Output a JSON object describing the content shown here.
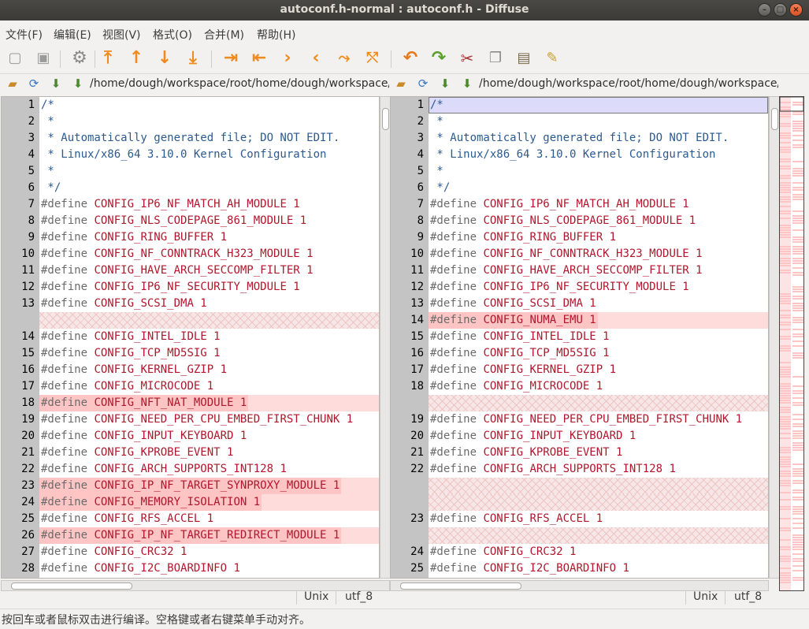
{
  "window": {
    "title": "autoconf.h-normal : autoconf.h - Diffuse"
  },
  "menu": [
    "文件(F)",
    "编辑(E)",
    "视图(V)",
    "格式(O)",
    "合并(M)",
    "帮助(H)"
  ],
  "toolbar": {
    "icons": [
      "new-2-way-merge-icon",
      "new-3-way-merge-icon",
      "realign-icon",
      "first-difference-icon",
      "previous-difference-icon",
      "next-difference-icon",
      "last-difference-icon",
      "copy-selection-right-icon",
      "copy-selection-left-icon",
      "copy-right-icon",
      "copy-left-icon",
      "merge-from-left-icon",
      "merge-from-right-icon",
      "undo-icon",
      "redo-icon",
      "cut-icon",
      "copy-icon",
      "paste-icon",
      "clear-edits-icon"
    ]
  },
  "colors": {
    "changed_line": "#ffdcdc",
    "changed_text": "#ffc4c4",
    "gutter": "#c4c4c4",
    "selection": "#dcdcfa"
  },
  "left": {
    "path": "/home/dough/workspace/root/home/dough/workspace/",
    "format": "Unix",
    "encoding": "utf_8",
    "rows": [
      {
        "n": "1",
        "text": "/*",
        "kind": "comment"
      },
      {
        "n": "2",
        "text": " *",
        "kind": "comment"
      },
      {
        "n": "3",
        "text": " * Automatically generated file; DO NOT EDIT.",
        "kind": "comment"
      },
      {
        "n": "4",
        "text": " * Linux/x86_64 3.10.0 Kernel Configuration",
        "kind": "comment"
      },
      {
        "n": "5",
        "text": " *",
        "kind": "comment"
      },
      {
        "n": "6",
        "text": " */",
        "kind": "comment"
      },
      {
        "n": "7",
        "text": "CONFIG_IP6_NF_MATCH_AH_MODULE 1",
        "kind": "define"
      },
      {
        "n": "8",
        "text": "CONFIG_NLS_CODEPAGE_861_MODULE 1",
        "kind": "define"
      },
      {
        "n": "9",
        "text": "CONFIG_RING_BUFFER 1",
        "kind": "define"
      },
      {
        "n": "10",
        "text": "CONFIG_NF_CONNTRACK_H323_MODULE 1",
        "kind": "define"
      },
      {
        "n": "11",
        "text": "CONFIG_HAVE_ARCH_SECCOMP_FILTER 1",
        "kind": "define"
      },
      {
        "n": "12",
        "text": "CONFIG_IP6_NF_SECURITY_MODULE 1",
        "kind": "define"
      },
      {
        "n": "13",
        "text": "CONFIG_SCSI_DMA 1",
        "kind": "define"
      },
      {
        "n": "",
        "text": "",
        "kind": "gap"
      },
      {
        "n": "14",
        "text": "CONFIG_INTEL_IDLE 1",
        "kind": "define"
      },
      {
        "n": "15",
        "text": "CONFIG_TCP_MD5SIG 1",
        "kind": "define"
      },
      {
        "n": "16",
        "text": "CONFIG_KERNEL_GZIP 1",
        "kind": "define"
      },
      {
        "n": "17",
        "text": "CONFIG_MICROCODE 1",
        "kind": "define"
      },
      {
        "n": "18",
        "text": "CONFIG_NFT_NAT_MODULE 1",
        "kind": "define-changed"
      },
      {
        "n": "19",
        "text": "CONFIG_NEED_PER_CPU_EMBED_FIRST_CHUNK 1",
        "kind": "define"
      },
      {
        "n": "20",
        "text": "CONFIG_INPUT_KEYBOARD 1",
        "kind": "define"
      },
      {
        "n": "21",
        "text": "CONFIG_KPROBE_EVENT 1",
        "kind": "define"
      },
      {
        "n": "22",
        "text": "CONFIG_ARCH_SUPPORTS_INT128 1",
        "kind": "define"
      },
      {
        "n": "23",
        "text": "CONFIG_IP_NF_TARGET_SYNPROXY_MODULE 1",
        "kind": "define-changed"
      },
      {
        "n": "24",
        "text": "CONFIG_MEMORY_ISOLATION 1",
        "kind": "define-changed"
      },
      {
        "n": "25",
        "text": "CONFIG_RFS_ACCEL 1",
        "kind": "define"
      },
      {
        "n": "26",
        "text": "CONFIG_IP_NF_TARGET_REDIRECT_MODULE 1",
        "kind": "define-changed"
      },
      {
        "n": "27",
        "text": "CONFIG_CRC32 1",
        "kind": "define"
      },
      {
        "n": "28",
        "text": "CONFIG_I2C_BOARDINFO 1",
        "kind": "define"
      }
    ]
  },
  "right": {
    "path": "/home/dough/workspace/root/home/dough/workspace/",
    "format": "Unix",
    "encoding": "utf_8",
    "rows": [
      {
        "n": "1",
        "text": "/*",
        "kind": "comment-selected"
      },
      {
        "n": "2",
        "text": " *",
        "kind": "comment"
      },
      {
        "n": "3",
        "text": " * Automatically generated file; DO NOT EDIT.",
        "kind": "comment"
      },
      {
        "n": "4",
        "text": " * Linux/x86_64 3.10.0 Kernel Configuration",
        "kind": "comment"
      },
      {
        "n": "5",
        "text": " *",
        "kind": "comment"
      },
      {
        "n": "6",
        "text": " */",
        "kind": "comment"
      },
      {
        "n": "7",
        "text": "CONFIG_IP6_NF_MATCH_AH_MODULE 1",
        "kind": "define"
      },
      {
        "n": "8",
        "text": "CONFIG_NLS_CODEPAGE_861_MODULE 1",
        "kind": "define"
      },
      {
        "n": "9",
        "text": "CONFIG_RING_BUFFER 1",
        "kind": "define"
      },
      {
        "n": "10",
        "text": "CONFIG_NF_CONNTRACK_H323_MODULE 1",
        "kind": "define"
      },
      {
        "n": "11",
        "text": "CONFIG_HAVE_ARCH_SECCOMP_FILTER 1",
        "kind": "define"
      },
      {
        "n": "12",
        "text": "CONFIG_IP6_NF_SECURITY_MODULE 1",
        "kind": "define"
      },
      {
        "n": "13",
        "text": "CONFIG_SCSI_DMA 1",
        "kind": "define"
      },
      {
        "n": "14",
        "text": "CONFIG_NUMA_EMU 1",
        "kind": "define-changed"
      },
      {
        "n": "15",
        "text": "CONFIG_INTEL_IDLE 1",
        "kind": "define"
      },
      {
        "n": "16",
        "text": "CONFIG_TCP_MD5SIG 1",
        "kind": "define"
      },
      {
        "n": "17",
        "text": "CONFIG_KERNEL_GZIP 1",
        "kind": "define"
      },
      {
        "n": "18",
        "text": "CONFIG_MICROCODE 1",
        "kind": "define"
      },
      {
        "n": "",
        "text": "",
        "kind": "gap"
      },
      {
        "n": "19",
        "text": "CONFIG_NEED_PER_CPU_EMBED_FIRST_CHUNK 1",
        "kind": "define"
      },
      {
        "n": "20",
        "text": "CONFIG_INPUT_KEYBOARD 1",
        "kind": "define"
      },
      {
        "n": "21",
        "text": "CONFIG_KPROBE_EVENT 1",
        "kind": "define"
      },
      {
        "n": "22",
        "text": "CONFIG_ARCH_SUPPORTS_INT128 1",
        "kind": "define"
      },
      {
        "n": "",
        "text": "",
        "kind": "gap"
      },
      {
        "n": "",
        "text": "",
        "kind": "gap"
      },
      {
        "n": "23",
        "text": "CONFIG_RFS_ACCEL 1",
        "kind": "define"
      },
      {
        "n": "",
        "text": "",
        "kind": "gap"
      },
      {
        "n": "24",
        "text": "CONFIG_CRC32 1",
        "kind": "define"
      },
      {
        "n": "25",
        "text": "CONFIG_I2C_BOARDINFO 1",
        "kind": "define"
      }
    ]
  },
  "define_keyword": "#define",
  "status": "按回车或者鼠标双击进行编译。空格键或者右键菜单手动对齐。"
}
